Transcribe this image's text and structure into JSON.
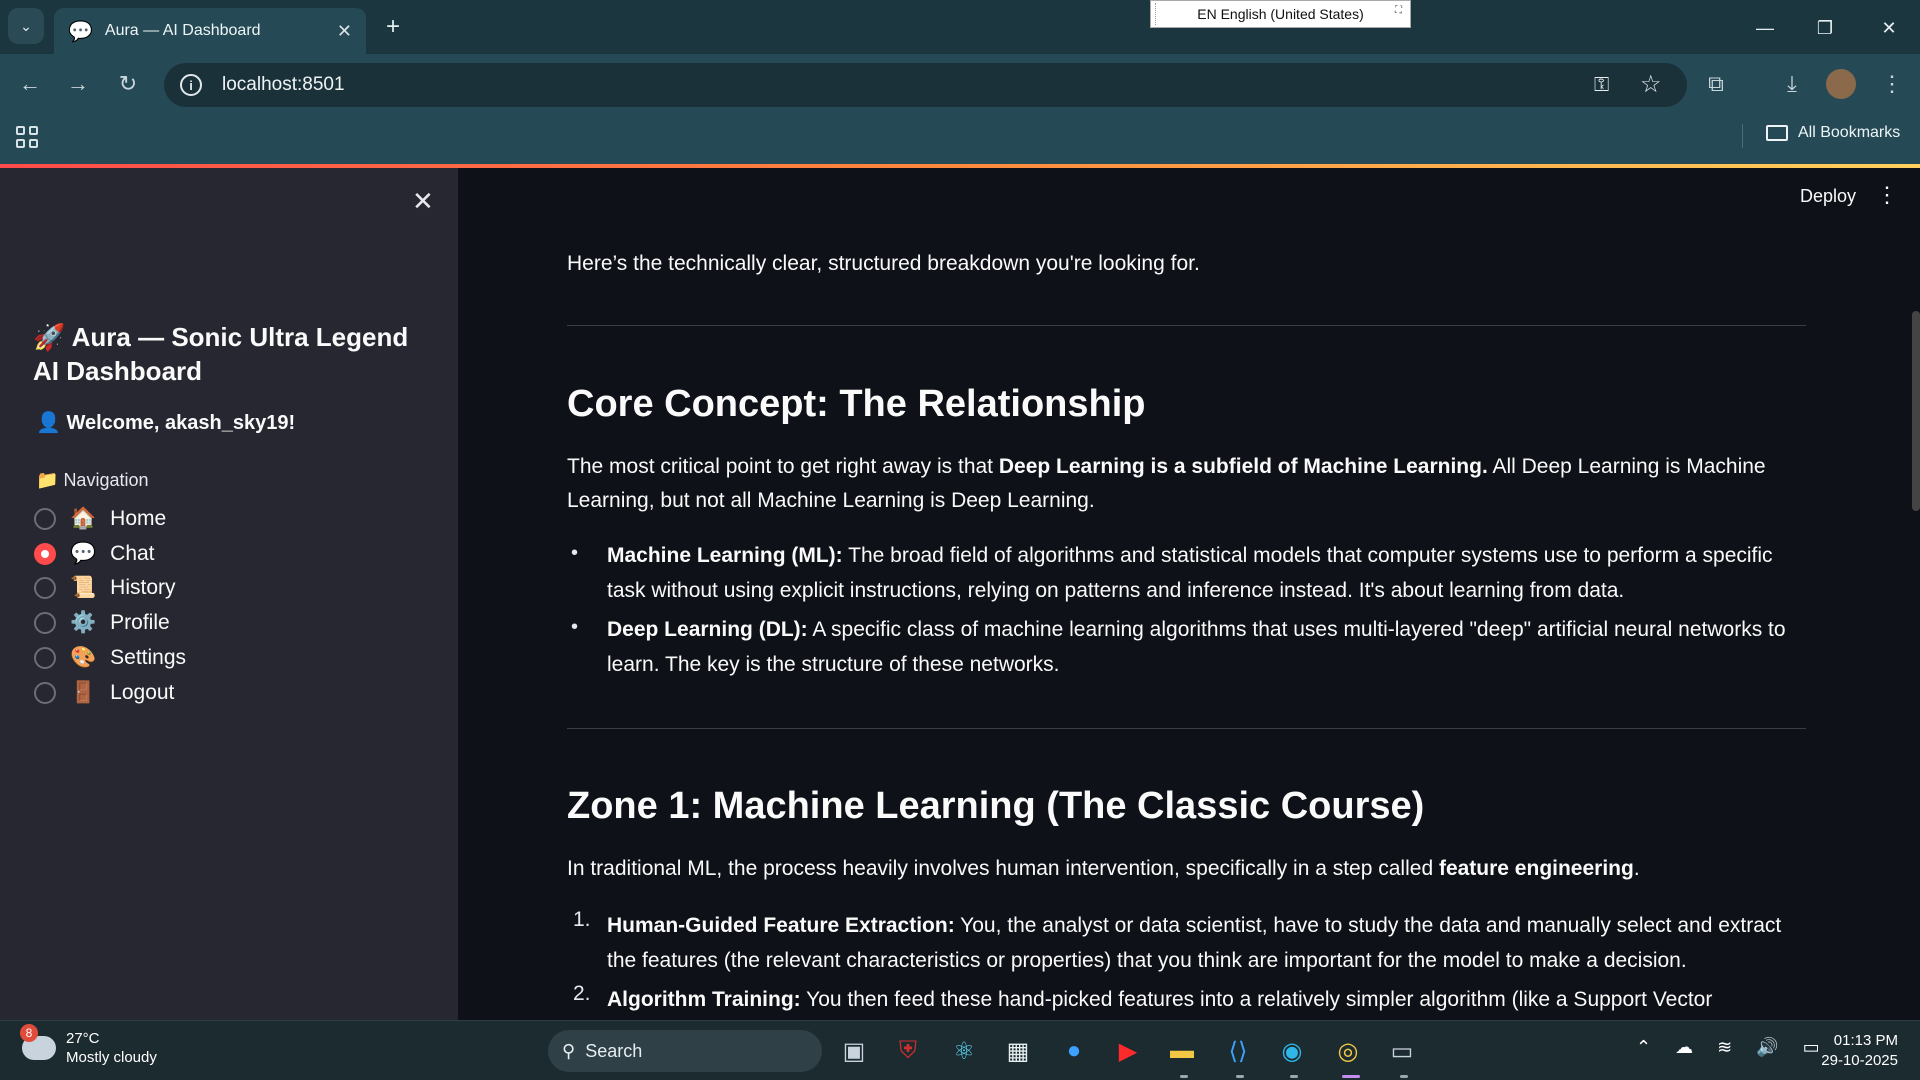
{
  "browser": {
    "tab_title": "Aura — AI Dashboard",
    "url": "localhost:8501",
    "bookmarks_label": "All Bookmarks",
    "language_popup": "EN English (United States)"
  },
  "sidebar": {
    "title": "Aura — Sonic Ultra Legend AI Dashboard",
    "welcome": "Welcome, akash_sky19!",
    "nav_label": "Navigation",
    "items": [
      {
        "label": "Home",
        "emoji": "🏠",
        "selected": false
      },
      {
        "label": "Chat",
        "emoji": "💬",
        "selected": true
      },
      {
        "label": "History",
        "emoji": "📜",
        "selected": false
      },
      {
        "label": "Profile",
        "emoji": "⚙️",
        "selected": false
      },
      {
        "label": "Settings",
        "emoji": "🎨",
        "selected": false
      },
      {
        "label": "Logout",
        "emoji": "🚪",
        "selected": false
      }
    ]
  },
  "header": {
    "deploy_label": "Deploy"
  },
  "content": {
    "intro": "Here’s the technically clear, structured breakdown you're looking for.",
    "section1": {
      "heading": "Core Concept: The Relationship",
      "para_pre": "The most critical point to get right away is that ",
      "para_bold": "Deep Learning is a subfield of Machine Learning.",
      "para_post": " All Deep Learning is Machine Learning, but not all Machine Learning is Deep Learning.",
      "bullets": [
        {
          "term": "Machine Learning (ML):",
          "text": " The broad field of algorithms and statistical models that computer systems use to perform a specific task without using explicit instructions, relying on patterns and inference instead. It's about learning from data."
        },
        {
          "term": "Deep Learning (DL):",
          "text": " A specific class of machine learning algorithms that uses multi-layered \"deep\" artificial neural networks to learn. The key is the structure of these networks."
        }
      ]
    },
    "section2": {
      "heading": "Zone 1: Machine Learning (The Classic Course)",
      "para_pre": "In traditional ML, the process heavily involves human intervention, specifically in a step called ",
      "para_bold": "feature engineering",
      "para_post": ".",
      "steps": [
        {
          "num": "1.",
          "term": "Human-Guided Feature Extraction:",
          "text": " You, the analyst or data scientist, have to study the data and manually select and extract the features (the relevant characteristics or properties) that you think are important for the model to make a decision."
        },
        {
          "num": "2.",
          "term": "Algorithm Training:",
          "text": " You then feed these hand-picked features into a relatively simpler algorithm (like a Support Vector Machine,"
        }
      ]
    }
  },
  "taskbar": {
    "weather_badge": "8",
    "temperature": "27°C",
    "weather": "Mostly cloudy",
    "search_label": "Search",
    "time": "01:13 PM",
    "date": "29-10-2025"
  }
}
